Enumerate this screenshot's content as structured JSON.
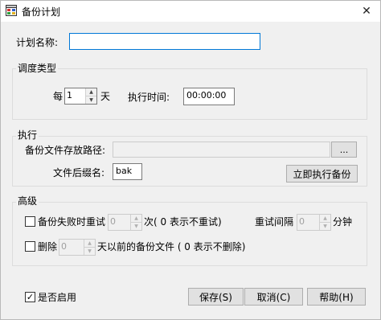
{
  "window": {
    "title": "备份计划",
    "close_glyph": "✕"
  },
  "plan_name": {
    "label": "计划名称:",
    "value": ""
  },
  "schedule": {
    "group_title": "调度类型",
    "every_label": "每",
    "every_value": "1",
    "unit_label": "天",
    "exec_time_label": "执行时间:",
    "exec_time_value": "00:00:00"
  },
  "execute": {
    "group_title": "执行",
    "path_label": "备份文件存放路径:",
    "path_value": "",
    "browse_label": "...",
    "suffix_label": "文件后缀名:",
    "suffix_value": "bak",
    "run_now_label": "立即执行备份"
  },
  "advanced": {
    "group_title": "高级",
    "retry_label": "备份失败时重试",
    "retry_value": "0",
    "retry_suffix": "次( 0 表示不重试)",
    "interval_label": "重试间隔",
    "interval_value": "0",
    "interval_unit": "分钟",
    "delete_label": "删除",
    "delete_value": "0",
    "delete_suffix": "天以前的备份文件 ( 0 表示不删除)"
  },
  "footer": {
    "enabled_label": "是否启用",
    "enabled_mark": "✓",
    "save_label": "保存(S)",
    "cancel_label": "取消(C)",
    "help_label": "帮助(H)"
  }
}
